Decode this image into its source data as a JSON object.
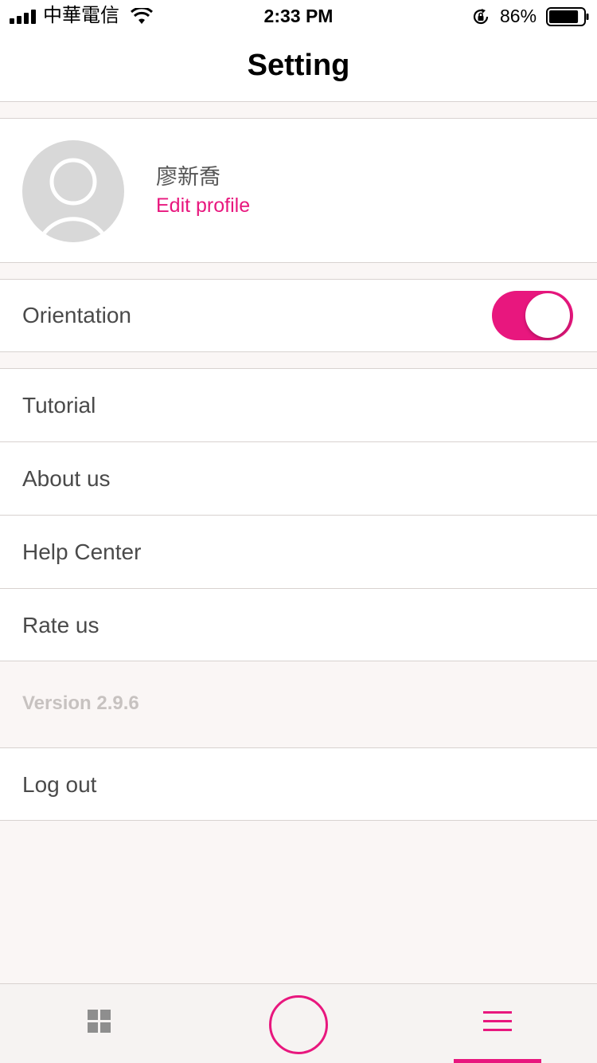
{
  "status_bar": {
    "carrier": "中華電信",
    "time": "2:33 PM",
    "battery_percent": "86%",
    "battery_level": 0.86,
    "icons": [
      "signal-icon",
      "wifi-icon",
      "rotation-lock-icon",
      "battery-icon"
    ]
  },
  "header": {
    "title": "Setting"
  },
  "profile": {
    "name": "廖新喬",
    "edit_label": "Edit profile",
    "avatar_icon": "user-avatar-icon"
  },
  "orientation": {
    "label": "Orientation",
    "enabled": true
  },
  "menu": {
    "items": [
      {
        "label": "Tutorial"
      },
      {
        "label": "About us"
      },
      {
        "label": "Help Center"
      },
      {
        "label": "Rate us"
      }
    ]
  },
  "version": "Version 2.9.6",
  "logout": {
    "label": "Log out"
  },
  "tab_bar": {
    "tabs": [
      {
        "icon": "grid-icon",
        "active": false
      },
      {
        "icon": "circle-icon",
        "active": false
      },
      {
        "icon": "hamburger-menu-icon",
        "active": true
      }
    ]
  },
  "colors": {
    "accent": "#e8177e",
    "background": "#faf6f5",
    "text": "#4a4a4a",
    "muted": "#c7c2c0"
  }
}
